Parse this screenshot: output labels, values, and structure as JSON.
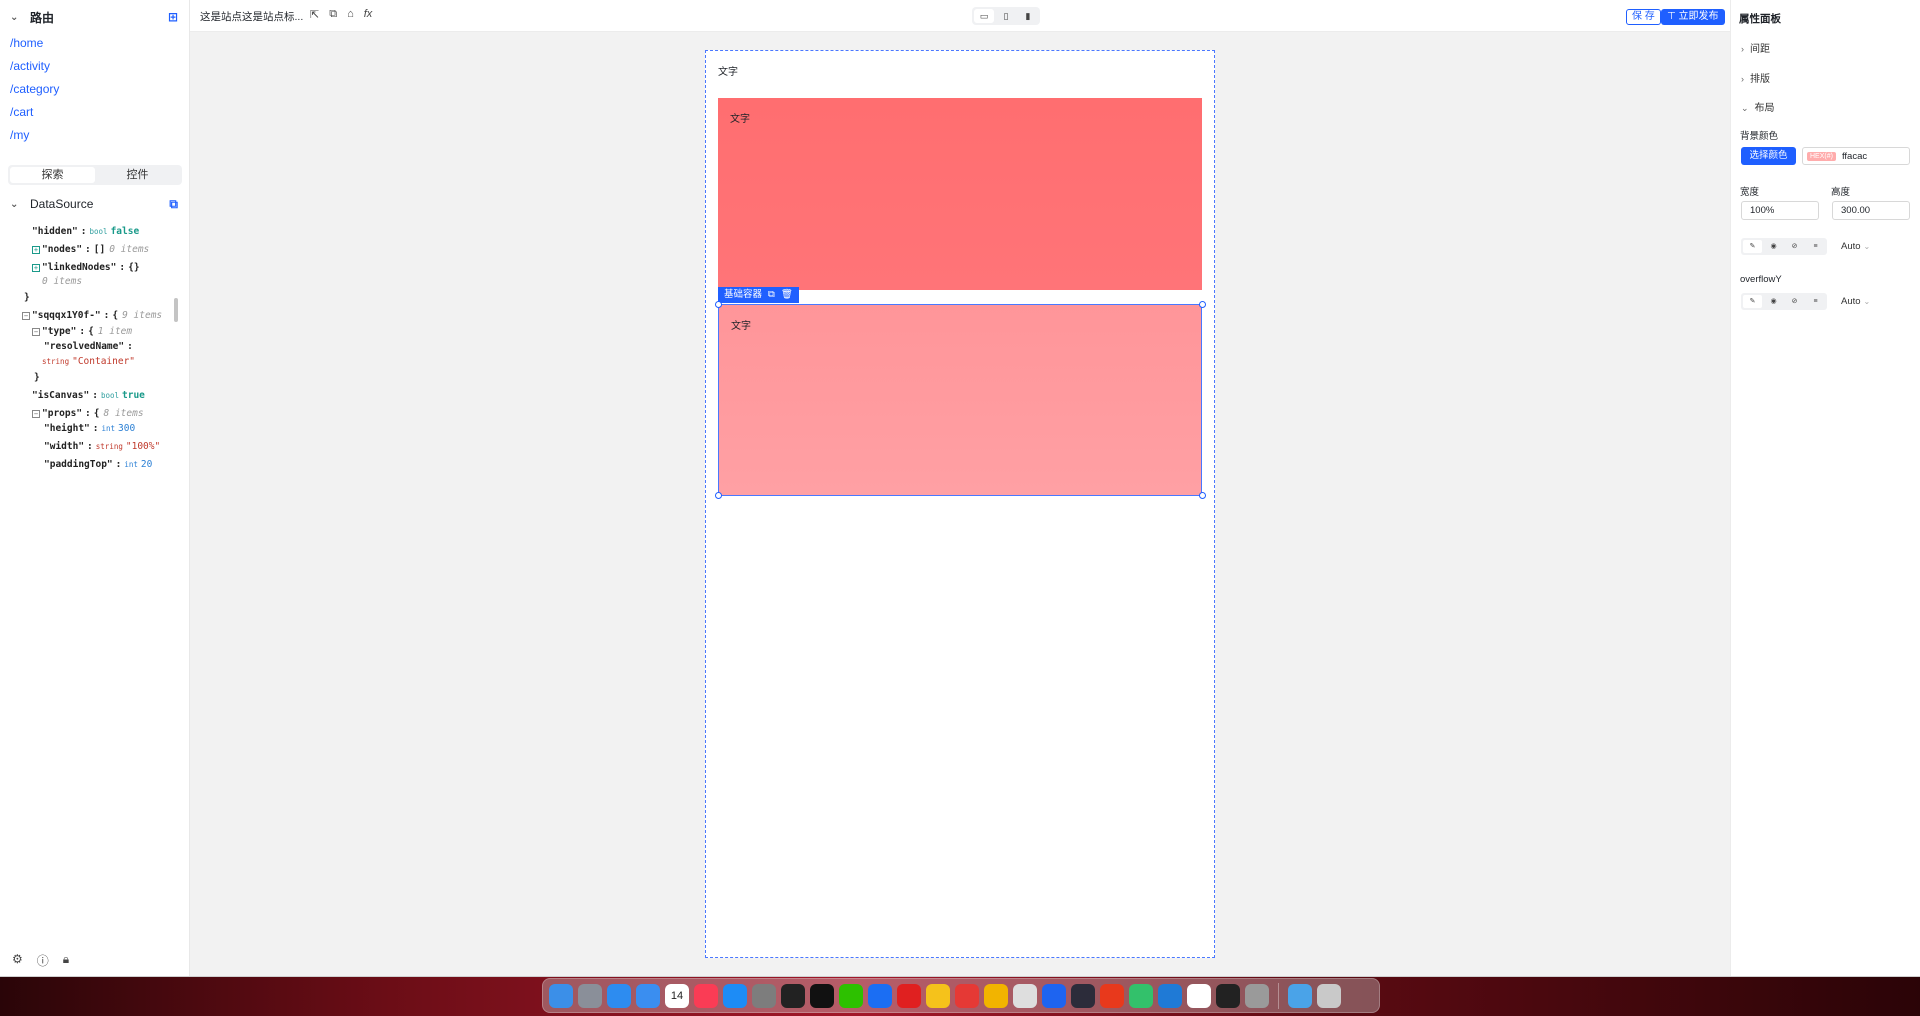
{
  "left": {
    "routes_title": "路由",
    "routes": [
      "/home",
      "/activity",
      "/category",
      "/cart",
      "/my"
    ],
    "tabs": [
      "探索",
      "控件"
    ],
    "datasource_title": "DataSource",
    "json": {
      "hidden_key": "\"hidden\"",
      "hidden_type": "bool",
      "hidden_val": "false",
      "nodes_key": "\"nodes\"",
      "nodes_val": "[]",
      "nodes_meta": "0 items",
      "linked_key": "\"linkedNodes\"",
      "linked_val": "{}",
      "linked_meta": "0 items",
      "close_brace": "}",
      "node_key": "\"sqqqx1Y0f-\"",
      "node_open": "{",
      "node_meta": "9 items",
      "type_key": "\"type\"",
      "type_open": "{",
      "type_meta": "1 item",
      "resolved_key": "\"resolvedName\"",
      "resolved_type": "string",
      "resolved_val": "\"Container\"",
      "type_close": "}",
      "canvas_key": "\"isCanvas\"",
      "canvas_type": "bool",
      "canvas_val": "true",
      "props_key": "\"props\"",
      "props_open": "{",
      "props_meta": "8 items",
      "height_key": "\"height\"",
      "height_type": "int",
      "height_val": "300",
      "width_key": "\"width\"",
      "width_type": "string",
      "width_val": "\"100%\"",
      "ptop_key": "\"paddingTop\"",
      "ptop_type": "int",
      "ptop_val": "20"
    }
  },
  "toolbar": {
    "site_title": "这是站点这是站点标...",
    "fx_label": "fx",
    "save_label": "保 存",
    "publish_label": "立即发布"
  },
  "canvas": {
    "frame_text": "文字",
    "box1_text": "文字",
    "box2_text": "文字",
    "selection_label": "基础容器"
  },
  "right": {
    "title": "属性面板",
    "sections": [
      "间距",
      "排版",
      "布局"
    ],
    "bg_color_label": "背景颜色",
    "pick_color": "选择颜色",
    "hex_badge": "HEX(#)",
    "hex_value": "ffacac",
    "width_label": "宽度",
    "width_value": "100%",
    "height_label": "高度",
    "height_value": "300.00",
    "auto_1": "Auto",
    "overflow_label": "overflowY",
    "auto_2": "Auto"
  },
  "colors": {
    "accent": "#1f5fff",
    "box1": "#ff7073",
    "box2": "#ffacac"
  },
  "dock_apps": [
    "finder",
    "launchpad",
    "safari",
    "mail",
    "calendar",
    "music",
    "app-store",
    "settings",
    "terminal",
    "qq",
    "wechat",
    "mail-alt",
    "netease-music",
    "nuts",
    "wps",
    "chrome",
    "messages",
    "maps",
    "davinci",
    "xmind",
    "feishu",
    "vscode",
    "notion",
    "activity-monitor",
    "font-book",
    "folder",
    "trash"
  ],
  "calendar_day": "14"
}
